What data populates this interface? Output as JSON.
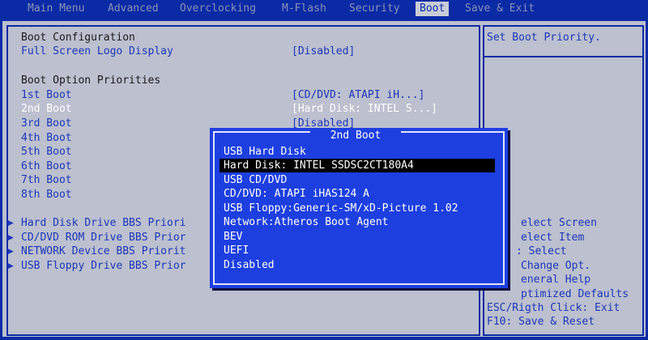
{
  "menubar": {
    "items": [
      "Main Menu",
      "Advanced",
      "Overclocking",
      "M-Flash",
      "Security",
      "Boot",
      "Save & Exit"
    ],
    "active_index": 5
  },
  "boot_configuration": {
    "section_title": "Boot Configuration",
    "full_screen_logo_label": "Full Screen Logo Display",
    "full_screen_logo_value": "[Disabled]"
  },
  "boot_priorities": {
    "section_title": "Boot Option Priorities",
    "items": [
      {
        "label": "1st Boot",
        "value": "[CD/DVD: ATAPI   iH...]"
      },
      {
        "label": "2nd Boot",
        "value": "[Hard Disk: INTEL S...]"
      },
      {
        "label": "3rd Boot",
        "value": "[Disabled]"
      },
      {
        "label": "4th Boot",
        "value": ""
      },
      {
        "label": "5th Boot",
        "value": ""
      },
      {
        "label": "6th Boot",
        "value": ""
      },
      {
        "label": "7th Boot",
        "value": ""
      },
      {
        "label": "8th Boot",
        "value": ""
      }
    ]
  },
  "submenus": [
    "Hard Disk Drive BBS Priori",
    "CD/DVD ROM Drive BBS Prior",
    "NETWORK Device BBS Priorit",
    "USB Floppy Drive BBS Prior"
  ],
  "help": {
    "description": "Set Boot Priority.",
    "keys": [
      "elect Screen",
      "elect Item",
      ": Select",
      "Change Opt.",
      "eneral Help",
      "ptimized Defaults",
      "ESC/Rigth Click: Exit",
      "F10: Save & Reset"
    ]
  },
  "popup": {
    "title": "2nd Boot",
    "options": [
      "USB Hard Disk",
      "Hard Disk: INTEL SSDSC2CT180A4",
      "USB CD/DVD",
      "CD/DVD: ATAPI   iHAS124   A",
      "USB Floppy:Generic-SM/xD-Picture 1.02",
      "Network:Atheros Boot Agent",
      "BEV",
      "UEFI",
      "Disabled"
    ],
    "selected_index": 1
  },
  "colors": {
    "bios_blue": "#0b2aa6",
    "panel_gray": "#bcc0cf",
    "popup_blue": "#1d3fe0",
    "selection_black": "#000000"
  }
}
